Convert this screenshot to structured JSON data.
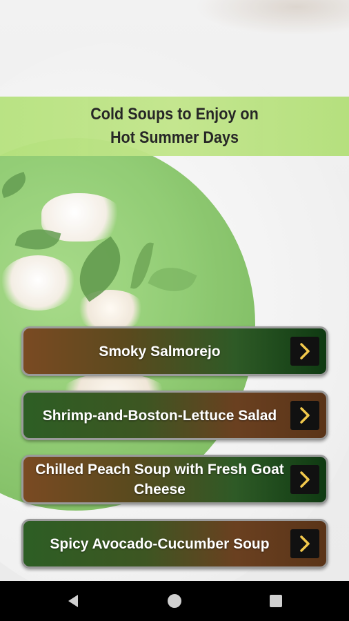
{
  "title": "Cold Soups to Enjoy on Hot Summer Days",
  "recipes": [
    {
      "label": "Smoky Salmorejo",
      "icon": "chevron-right-icon"
    },
    {
      "label": "Shrimp-and-Boston-Lettuce Salad",
      "icon": "chevron-right-icon"
    },
    {
      "label": "Chilled Peach Soup with Fresh Goat Cheese",
      "icon": "chevron-right-icon"
    },
    {
      "label": "Spicy Avocado-Cucumber Soup",
      "icon": "chevron-right-icon"
    }
  ],
  "colors": {
    "banner": "#b6e27e",
    "chevron": "#f2c94c",
    "navbar": "#000000"
  },
  "navbar": {
    "back_icon": "back-triangle-icon",
    "home_icon": "home-circle-icon",
    "recents_icon": "recents-square-icon"
  }
}
